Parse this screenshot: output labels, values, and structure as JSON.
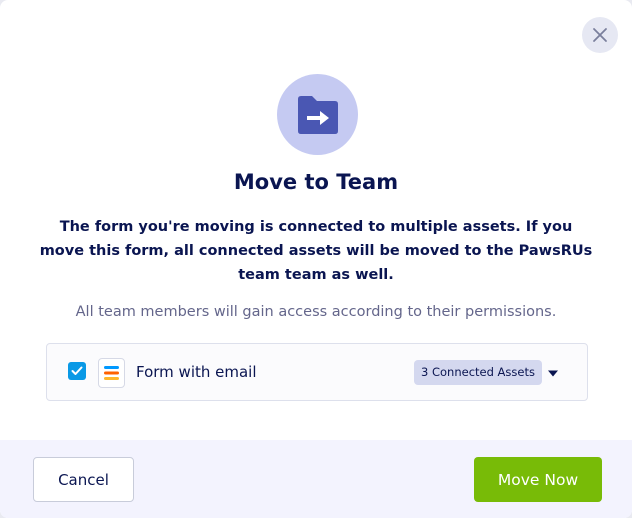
{
  "dialog": {
    "title": "Move to Team",
    "description": "The form you're moving is connected to multiple assets. If you move this form, all connected assets will be moved to the PawsRUs team team as well.",
    "note": "All team members will gain access according to their permissions.",
    "close_icon": "close-icon",
    "hero_icon": "folder-move-icon"
  },
  "asset": {
    "checked": true,
    "icon": "form-icon",
    "name": "Form with email",
    "badge": "3 Connected Assets",
    "expand_icon": "caret-down-icon"
  },
  "footer": {
    "cancel_label": "Cancel",
    "move_label": "Move Now"
  },
  "colors": {
    "primary_text": "#0a1551",
    "secondary_text": "#64668b",
    "checkbox": "#0a99e6",
    "move_button": "#78bb07",
    "hero_circle": "#c5caf2",
    "hero_icon": "#4a57b3",
    "footer_bg": "#f3f3fe"
  }
}
